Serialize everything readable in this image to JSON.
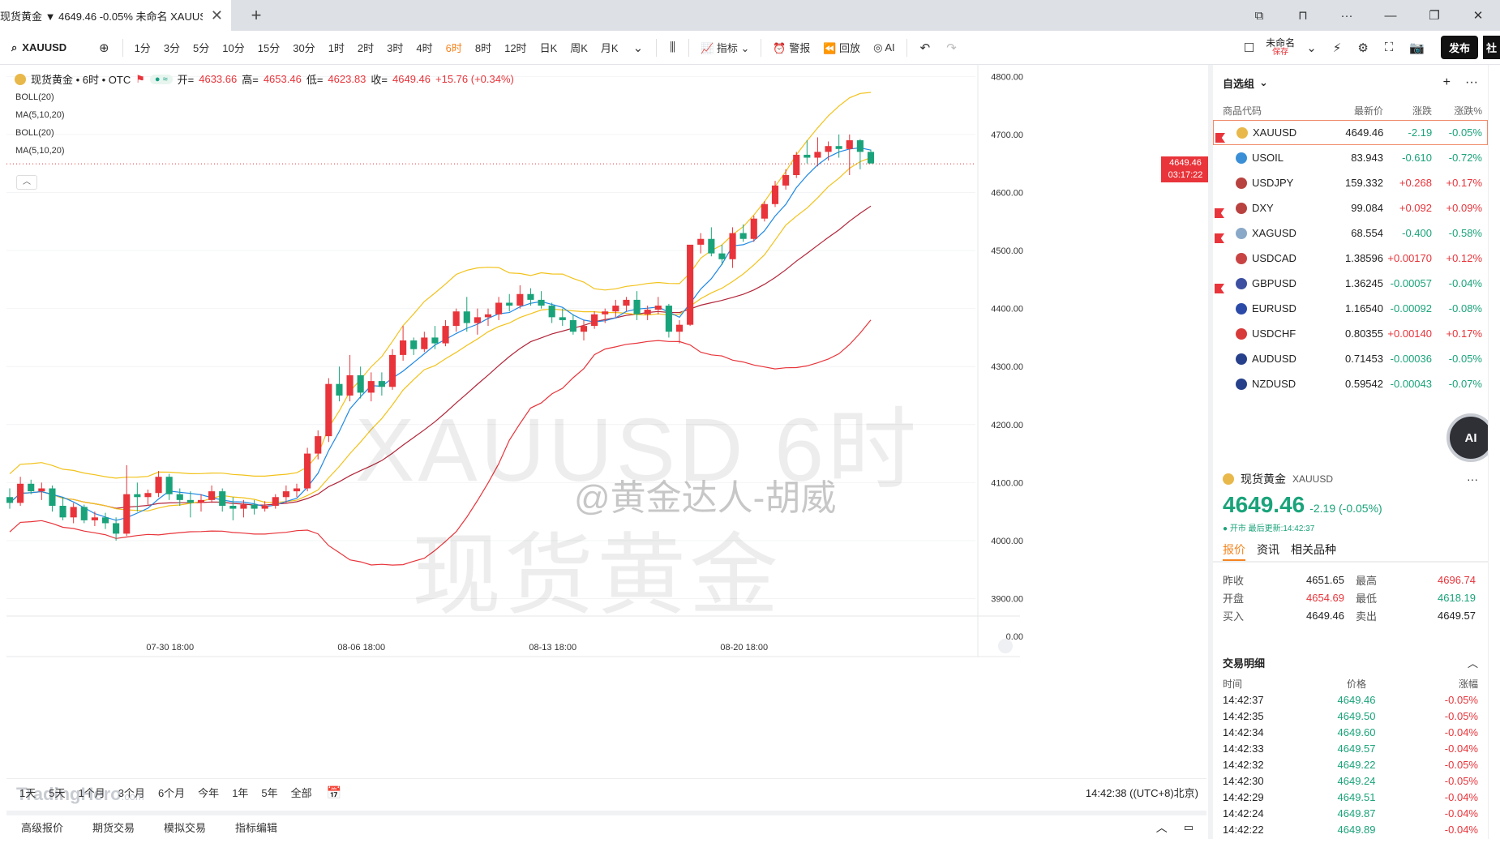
{
  "tab": {
    "title": "现货黄金 ▼  4649.46 -0.05% 未命名 XAUUSD"
  },
  "toolbar": {
    "symbol": "XAUUSD",
    "intervals": [
      "1分",
      "3分",
      "5分",
      "10分",
      "15分",
      "30分",
      "1时",
      "2时",
      "3时",
      "4时",
      "6时",
      "8时",
      "12时",
      "日K",
      "周K",
      "月K"
    ],
    "active_interval": "6时",
    "indicator_label": "指标",
    "alert_label": "警报",
    "replay_label": "回放",
    "ai_label": "AI",
    "layout_name": "未命名",
    "layout_status": "保存",
    "publish_label": "发布",
    "community_label": "社"
  },
  "legend": {
    "name": "现货黄金 • 6时 • OTC",
    "open_label": "开=",
    "open": "4633.66",
    "high_label": "高=",
    "high": "4653.46",
    "low_label": "低=",
    "low": "4623.83",
    "close_label": "收=",
    "close": "4649.46",
    "change": "+15.76 (+0.34%)"
  },
  "indicators": [
    "BOLL(20)",
    "MA(5,10,20)",
    "BOLL(20)",
    "MA(5,10,20)"
  ],
  "watermarks": {
    "symbol": "XAUUSD 6时",
    "name": "现货黄金",
    "weibo": "@黄金达人-胡威"
  },
  "brand": {
    "name": "TradingHero",
    "suffix": ".com"
  },
  "price_tag": {
    "price": "4649.46",
    "countdown": "03:17:22"
  },
  "range_bar": {
    "items": [
      "1天",
      "5天",
      "1个月",
      "3个月",
      "6个月",
      "今年",
      "1年",
      "5年",
      "全部"
    ],
    "time": "14:42:38 ((UTC+8)北京)"
  },
  "panel_bar": {
    "items": [
      "高级报价",
      "期货交易",
      "模拟交易",
      "指标编辑"
    ]
  },
  "watchlist": {
    "title": "自选组",
    "cols": [
      "商品代码",
      "最新价",
      "涨跌",
      "涨跌%"
    ],
    "rows": [
      {
        "sym": "XAUUSD",
        "price": "4649.46",
        "chg": "-2.19",
        "pct": "-0.05%",
        "flag": true,
        "color": "#e8b84a",
        "dir": "down"
      },
      {
        "sym": "USOIL",
        "price": "83.943",
        "chg": "-0.610",
        "pct": "-0.72%",
        "flag": false,
        "color": "#3a8fd6",
        "dir": "down"
      },
      {
        "sym": "USDJPY",
        "price": "159.332",
        "chg": "+0.268",
        "pct": "+0.17%",
        "flag": false,
        "color": "#b8423f",
        "dir": "up"
      },
      {
        "sym": "DXY",
        "price": "99.084",
        "chg": "+0.092",
        "pct": "+0.09%",
        "flag": true,
        "color": "#b8423f",
        "dir": "up"
      },
      {
        "sym": "XAGUSD",
        "price": "68.554",
        "chg": "-0.400",
        "pct": "-0.58%",
        "flag": true,
        "color": "#8aa8c8",
        "dir": "down"
      },
      {
        "sym": "USDCAD",
        "price": "1.38596",
        "chg": "+0.00170",
        "pct": "+0.12%",
        "flag": false,
        "color": "#c84444",
        "dir": "up"
      },
      {
        "sym": "GBPUSD",
        "price": "1.36245",
        "chg": "-0.00057",
        "pct": "-0.04%",
        "flag": true,
        "color": "#3c4fa0",
        "dir": "down"
      },
      {
        "sym": "EURUSD",
        "price": "1.16540",
        "chg": "-0.00092",
        "pct": "-0.08%",
        "flag": false,
        "color": "#2b4aa8",
        "dir": "down"
      },
      {
        "sym": "USDCHF",
        "price": "0.80355",
        "chg": "+0.00140",
        "pct": "+0.17%",
        "flag": false,
        "color": "#d83a3a",
        "dir": "up"
      },
      {
        "sym": "AUDUSD",
        "price": "0.71453",
        "chg": "-0.00036",
        "pct": "-0.05%",
        "flag": false,
        "color": "#27408b",
        "dir": "down"
      },
      {
        "sym": "NZDUSD",
        "price": "0.59542",
        "chg": "-0.00043",
        "pct": "-0.07%",
        "flag": false,
        "color": "#27408b",
        "dir": "down"
      }
    ]
  },
  "ai_badge": "AI",
  "quote": {
    "name": "现货黄金",
    "symbol": "XAUUSD",
    "price": "4649.46",
    "change": "-2.19 (-0.05%)",
    "status": "● 开市 最后更新:14:42:37",
    "tabs": [
      "报价",
      "资讯",
      "相关品种"
    ],
    "fields": [
      {
        "l1": "昨收",
        "v1": "4651.65",
        "l2": "最高",
        "v2": "4696.74",
        "c1": "",
        "c2": "red"
      },
      {
        "l1": "开盘",
        "v1": "4654.69",
        "l2": "最低",
        "v2": "4618.19",
        "c1": "red",
        "c2": "green"
      },
      {
        "l1": "买入",
        "v1": "4649.46",
        "l2": "卖出",
        "v2": "4649.57",
        "c1": "",
        "c2": ""
      }
    ]
  },
  "trades": {
    "title": "交易明细",
    "cols": [
      "时间",
      "价格",
      "涨幅"
    ],
    "rows": [
      {
        "t": "14:42:37",
        "p": "4649.46",
        "c": "-0.05%"
      },
      {
        "t": "14:42:35",
        "p": "4649.50",
        "c": "-0.05%"
      },
      {
        "t": "14:42:34",
        "p": "4649.60",
        "c": "-0.04%"
      },
      {
        "t": "14:42:33",
        "p": "4649.57",
        "c": "-0.04%"
      },
      {
        "t": "14:42:32",
        "p": "4649.22",
        "c": "-0.05%"
      },
      {
        "t": "14:42:30",
        "p": "4649.24",
        "c": "-0.05%"
      },
      {
        "t": "14:42:29",
        "p": "4649.51",
        "c": "-0.04%"
      },
      {
        "t": "14:42:24",
        "p": "4649.87",
        "c": "-0.04%"
      },
      {
        "t": "14:42:22",
        "p": "4649.89",
        "c": "-0.04%"
      }
    ]
  },
  "chart_data": {
    "type": "candlestick",
    "symbol": "XAUUSD",
    "interval": "6时",
    "y_axis_ticks": [
      "4800.00",
      "4700.00",
      "4600.00",
      "4500.00",
      "4400.00",
      "4300.00",
      "4200.00",
      "4100.00",
      "4000.00",
      "3900.00",
      "0.00"
    ],
    "ylim": [
      3870,
      4820
    ],
    "x_axis_ticks": [
      "07-30 18:00",
      "08-06 18:00",
      "08-13 18:00",
      "08-20 18:00"
    ],
    "last_price": 4649.46,
    "candles": [
      [
        4075,
        4090,
        4055,
        4065
      ],
      [
        4065,
        4110,
        4060,
        4098
      ],
      [
        4098,
        4105,
        4080,
        4085
      ],
      [
        4085,
        4100,
        4070,
        4090
      ],
      [
        4090,
        4095,
        4050,
        4060
      ],
      [
        4060,
        4075,
        4035,
        4040
      ],
      [
        4040,
        4065,
        4030,
        4058
      ],
      [
        4058,
        4062,
        4030,
        4035
      ],
      [
        4035,
        4050,
        4025,
        4040
      ],
      [
        4040,
        4048,
        4020,
        4030
      ],
      [
        4030,
        4040,
        4000,
        4012
      ],
      [
        4012,
        4130,
        4008,
        4080
      ],
      [
        4080,
        4100,
        4050,
        4075
      ],
      [
        4075,
        4088,
        4060,
        4082
      ],
      [
        4082,
        4120,
        4075,
        4110
      ],
      [
        4110,
        4115,
        4070,
        4080
      ],
      [
        4080,
        4090,
        4060,
        4070
      ],
      [
        4070,
        4085,
        4040,
        4065
      ],
      [
        4065,
        4080,
        4050,
        4070
      ],
      [
        4070,
        4095,
        4065,
        4085
      ],
      [
        4085,
        4090,
        4050,
        4060
      ],
      [
        4060,
        4075,
        4035,
        4055
      ],
      [
        4055,
        4070,
        4040,
        4062
      ],
      [
        4062,
        4070,
        4045,
        4055
      ],
      [
        4055,
        4068,
        4050,
        4060
      ],
      [
        4060,
        4080,
        4055,
        4075
      ],
      [
        4075,
        4095,
        4065,
        4085
      ],
      [
        4085,
        4098,
        4075,
        4090
      ],
      [
        4090,
        4160,
        4085,
        4150
      ],
      [
        4150,
        4190,
        4140,
        4180
      ],
      [
        4180,
        4280,
        4170,
        4270
      ],
      [
        4270,
        4300,
        4240,
        4250
      ],
      [
        4250,
        4320,
        4240,
        4285
      ],
      [
        4285,
        4300,
        4245,
        4255
      ],
      [
        4255,
        4290,
        4240,
        4275
      ],
      [
        4275,
        4290,
        4250,
        4265
      ],
      [
        4265,
        4330,
        4260,
        4320
      ],
      [
        4320,
        4370,
        4310,
        4345
      ],
      [
        4345,
        4350,
        4320,
        4330
      ],
      [
        4330,
        4360,
        4325,
        4350
      ],
      [
        4350,
        4370,
        4330,
        4340
      ],
      [
        4340,
        4380,
        4335,
        4370
      ],
      [
        4370,
        4400,
        4360,
        4395
      ],
      [
        4395,
        4420,
        4360,
        4375
      ],
      [
        4375,
        4400,
        4355,
        4385
      ],
      [
        4385,
        4400,
        4370,
        4390
      ],
      [
        4390,
        4420,
        4380,
        4410
      ],
      [
        4410,
        4425,
        4395,
        4405
      ],
      [
        4405,
        4440,
        4400,
        4425
      ],
      [
        4425,
        4435,
        4405,
        4415
      ],
      [
        4415,
        4430,
        4400,
        4405
      ],
      [
        4405,
        4410,
        4375,
        4385
      ],
      [
        4385,
        4400,
        4370,
        4380
      ],
      [
        4380,
        4390,
        4355,
        4360
      ],
      [
        4360,
        4380,
        4345,
        4370
      ],
      [
        4370,
        4395,
        4365,
        4390
      ],
      [
        4390,
        4400,
        4375,
        4395
      ],
      [
        4395,
        4415,
        4385,
        4405
      ],
      [
        4405,
        4420,
        4395,
        4415
      ],
      [
        4415,
        4430,
        4380,
        4390
      ],
      [
        4390,
        4405,
        4380,
        4398
      ],
      [
        4398,
        4420,
        4390,
        4405
      ],
      [
        4405,
        4408,
        4350,
        4360
      ],
      [
        4360,
        4380,
        4340,
        4372
      ],
      [
        4372,
        4420,
        4370,
        4510
      ],
      [
        4510,
        4530,
        4495,
        4520
      ],
      [
        4520,
        4540,
        4490,
        4495
      ],
      [
        4495,
        4510,
        4475,
        4485
      ],
      [
        4485,
        4540,
        4470,
        4530
      ],
      [
        4530,
        4545,
        4515,
        4520
      ],
      [
        4520,
        4560,
        4515,
        4555
      ],
      [
        4555,
        4585,
        4550,
        4580
      ],
      [
        4580,
        4620,
        4575,
        4612
      ],
      [
        4612,
        4640,
        4605,
        4630
      ],
      [
        4630,
        4670,
        4625,
        4665
      ],
      [
        4665,
        4690,
        4650,
        4660
      ],
      [
        4660,
        4695,
        4645,
        4670
      ],
      [
        4670,
        4688,
        4655,
        4680
      ],
      [
        4680,
        4700,
        4660,
        4675
      ],
      [
        4675,
        4700,
        4630,
        4690
      ],
      [
        4690,
        4692,
        4640,
        4670
      ],
      [
        4670,
        4674,
        4655,
        4650
      ]
    ]
  }
}
